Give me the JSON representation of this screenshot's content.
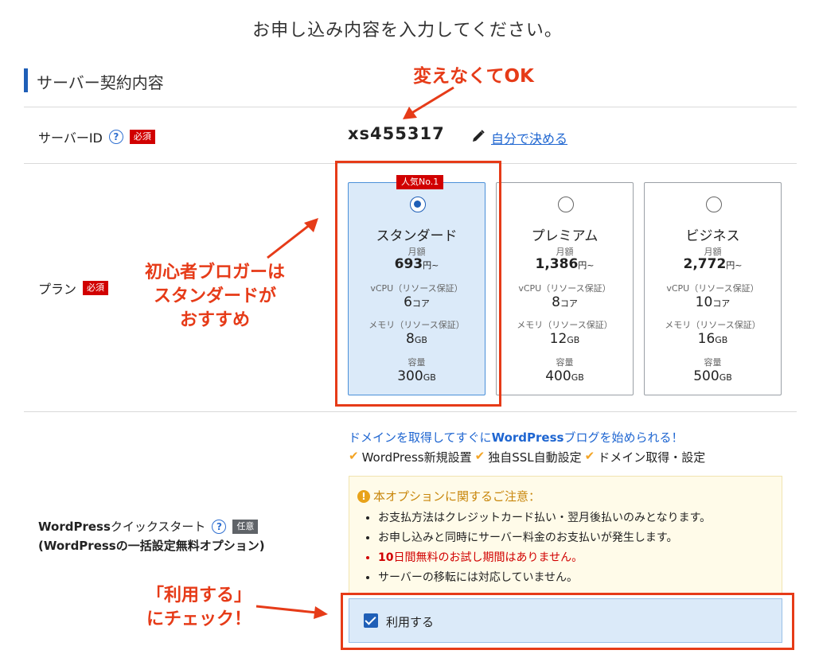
{
  "page_title": "お申し込み内容を入力してください。",
  "section_title": "サーバー契約内容",
  "server_id": {
    "label": "サーバーID",
    "required_badge": "必須",
    "value": "xs455317",
    "link_text": "自分で決める"
  },
  "plan": {
    "label": "プラン",
    "required_badge": "必須",
    "popular_badge": "人気No.1",
    "monthly_label": "月額",
    "price_suffix": "円~",
    "vcpu_label": "vCPU（リソース保証）",
    "vcpu_unit": "コア",
    "memory_label": "メモリ（リソース保証）",
    "memory_unit": "GB",
    "storage_label": "容量",
    "storage_unit": "GB",
    "cards": [
      {
        "name": "スタンダード",
        "price": "693",
        "vcpu": "6",
        "memory": "8",
        "storage": "300",
        "selected": true
      },
      {
        "name": "プレミアム",
        "price": "1,386",
        "vcpu": "8",
        "memory": "12",
        "storage": "400",
        "selected": false
      },
      {
        "name": "ビジネス",
        "price": "2,772",
        "vcpu": "10",
        "memory": "16",
        "storage": "500",
        "selected": false
      }
    ]
  },
  "wp": {
    "label_brand": "WordPress",
    "label_rest": "クイックスタート",
    "optional_badge": "任意",
    "sub_open": "(",
    "sub_brand": "WordPress",
    "sub_rest": "の一括設定無料オプション)",
    "lead_pre": "ドメインを取得してすぐに",
    "lead_brand": "WordPress",
    "lead_post": "ブログを始められる！",
    "features": [
      "WordPress新規設置",
      "独自SSL自動設定",
      "ドメイン取得・設定"
    ],
    "notice_title": "本オプションに関するご注意：",
    "notice_items": [
      "お支払方法はクレジットカード払い・翌月後払いのみとなります。",
      "お申し込みと同時にサーバー料金のお支払いが発生します。",
      "10日間無料のお試し期間はありません。",
      "サーバーの移転には対応していません。"
    ],
    "notice_red_bold": "10",
    "notice_red_rest": "日間無料のお試し期間はありません。",
    "use_label": "利用する",
    "use_checked": true
  },
  "annotations": {
    "ok": "変えなくてOK",
    "beginner_1": "初心者ブロガーは",
    "beginner_2": "スタンダードが",
    "beginner_3": "おすすめ",
    "check_1": "「利用する」",
    "check_2": "にチェック！"
  },
  "colors": {
    "accent": "#1f5fb7",
    "required": "#d10000",
    "annotation": "#e63b18",
    "notice_bg": "#fffbe9",
    "selected_bg": "#dbeaf9"
  }
}
